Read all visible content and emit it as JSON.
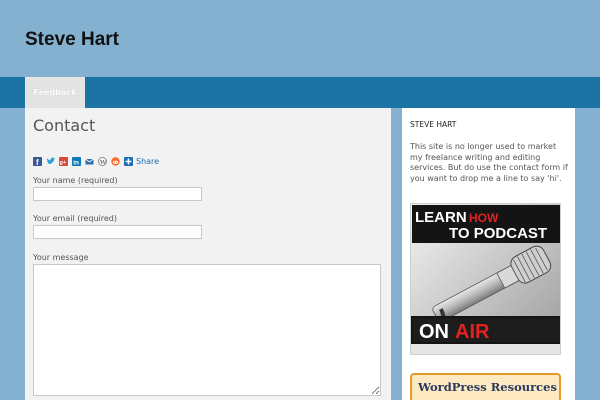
{
  "site": {
    "title": "Steve Hart"
  },
  "nav": {
    "items": [
      {
        "label": "Feedback"
      }
    ]
  },
  "main": {
    "page_title": "Contact",
    "share": {
      "label": "Share",
      "icons": [
        "facebook-icon",
        "twitter-icon",
        "google-plus-icon",
        "linkedin-icon",
        "email-icon",
        "wordpress-icon",
        "reddit-icon",
        "share-plus-icon"
      ]
    },
    "form": {
      "name_label": "Your name (required)",
      "name_value": "",
      "email_label": "Your email (required)",
      "email_value": "",
      "message_label": "Your message",
      "message_value": ""
    }
  },
  "sidebar": {
    "title": "STEVE HART",
    "text": "This site is no longer used to market my freelance writing and editing services. But do use the contact form if you want to drop me a line to say 'hi'.",
    "podcast_banner": {
      "line1_a": "LEARN",
      "line1_b": "HOW",
      "line2": "TO PODCAST",
      "on": "ON",
      "air": "AIR"
    },
    "wp_banner": "WordPress Resources"
  },
  "colors": {
    "background": "#85b1d0",
    "nav_bar": "#1b74a3",
    "content_bg": "#f2f2f2",
    "link_blue": "#1a6db0",
    "wp_border": "#e69b29"
  }
}
